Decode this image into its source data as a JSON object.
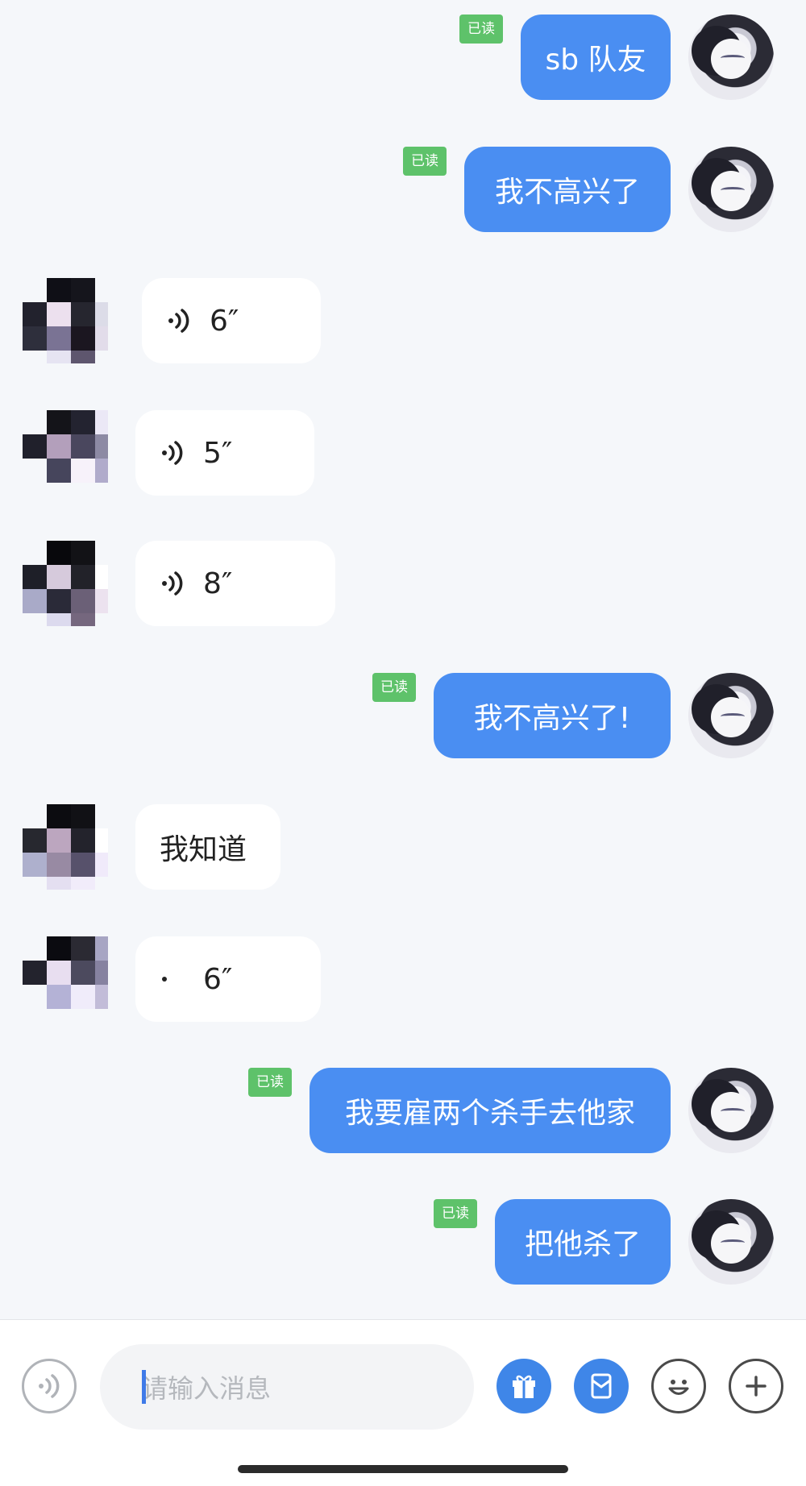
{
  "messages": [
    {
      "side": "me",
      "text": "sb 队友",
      "read": "已读"
    },
    {
      "side": "me",
      "text": "我不高兴了",
      "read": "已读"
    },
    {
      "side": "other",
      "type": "voice",
      "duration": "6″"
    },
    {
      "side": "other",
      "type": "voice",
      "duration": "5″"
    },
    {
      "side": "other",
      "type": "voice",
      "duration": "8″"
    },
    {
      "side": "me",
      "text": "我不高兴了!",
      "read": "已读"
    },
    {
      "side": "other",
      "text": "我知道"
    },
    {
      "side": "other",
      "type": "voice",
      "duration": "6″"
    },
    {
      "side": "me",
      "text": "我要雇两个杀手去他家",
      "read": "已读"
    },
    {
      "side": "me",
      "text": "把他杀了",
      "read": "已读"
    }
  ],
  "input": {
    "placeholder": "请输入消息",
    "buttons": [
      "voice-icon",
      "gift-icon",
      "red-packet-icon",
      "emoji-icon",
      "plus-icon"
    ]
  },
  "colors": {
    "my_bubble": "#4a8ef2",
    "other_bubble": "#ffffff",
    "read_badge": "#5ec26a",
    "background": "#f5f7fa",
    "accent_button": "#3f86e8"
  }
}
